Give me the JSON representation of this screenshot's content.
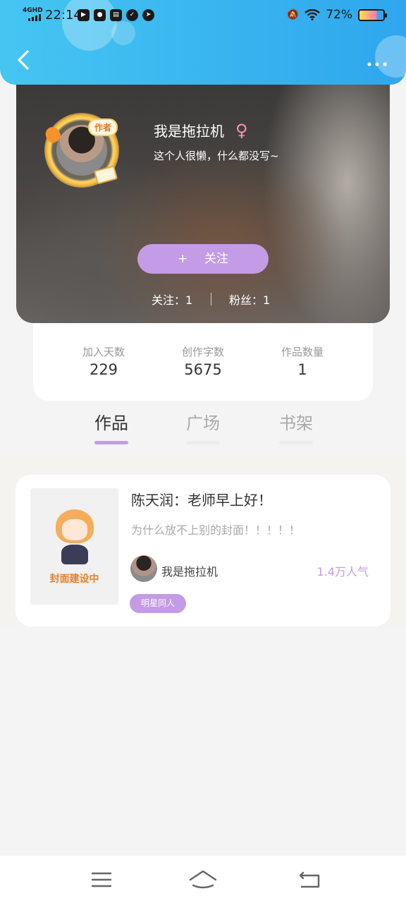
{
  "status_bar": {
    "network": "4GHD",
    "time": "22:14",
    "battery": "72%"
  },
  "header": {
    "back_icon": "chevron-left-icon",
    "more_icon": "more-dots-icon"
  },
  "profile": {
    "author_tag": "作者",
    "username": "我是拖拉机",
    "gender_symbol": "♀",
    "bio": "这个人很懒，什么都没写~",
    "follow_plus": "+",
    "follow_label": "关注",
    "following": "关注：1",
    "fans": "粉丝：1"
  },
  "stats": [
    {
      "label": "加入天数",
      "value": "229"
    },
    {
      "label": "创作字数",
      "value": "5675"
    },
    {
      "label": "作品数量",
      "value": "1"
    }
  ],
  "tabs": [
    {
      "label": "作品",
      "active": true
    },
    {
      "label": "广场",
      "active": false
    },
    {
      "label": "书架",
      "active": false
    }
  ],
  "works": [
    {
      "cover_text": "封面建设中",
      "title": "陈天润：老师早上好！",
      "description": "为什么放不上别的封面！！！！！",
      "author": "我是拖拉机",
      "popularity": "1.4万人气",
      "tag": "明星同人"
    }
  ],
  "colors": {
    "header_blue": "#39b4ef",
    "accent_purple": "#c49be6",
    "cover_orange": "#e8812b"
  }
}
